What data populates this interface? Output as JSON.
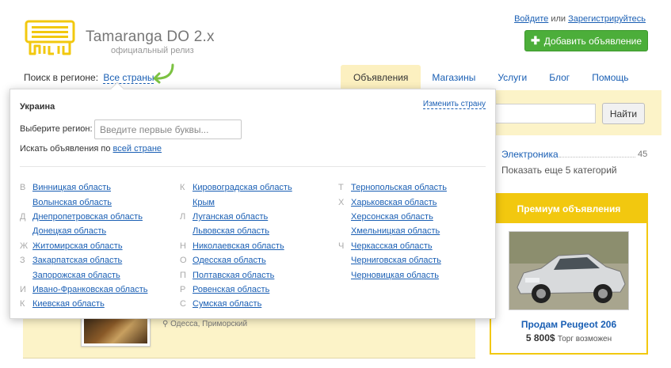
{
  "header": {
    "brand": "Tamaranga DO 2.x",
    "brand_sub": "официальный релиз",
    "auth_login": "Войдите",
    "auth_or": "или",
    "auth_register": "Зарегистрируйтесь",
    "add_button": "Добавить объявление",
    "search_region_label": "Поиск в регионе:",
    "search_region_value": "Все страны"
  },
  "nav": {
    "tabs": [
      {
        "label": "Объявления",
        "active": true
      },
      {
        "label": "Магазины"
      },
      {
        "label": "Услуги"
      },
      {
        "label": "Блог"
      },
      {
        "label": "Помощь"
      }
    ]
  },
  "search": {
    "find_button": "Найти"
  },
  "categories": {
    "item_label": "Электроника",
    "item_count": "45",
    "more": "Показать еще 5 категорий"
  },
  "premium": {
    "title": "Премиум объявления",
    "item_title": "Продам Peugeot 206",
    "price": "5 800$",
    "price_note": "Торг возможен"
  },
  "listing": {
    "location": "Одесса, Приморский"
  },
  "popup": {
    "country": "Украина",
    "change_country": "Изменить страну",
    "choose_region_label": "Выберите регион:",
    "region_placeholder": "Введите первые буквы...",
    "all_country_prefix": "Искать объявления по",
    "all_country_link": "всей стране",
    "columns": [
      [
        {
          "letter": "В",
          "name": "Винницкая область"
        },
        {
          "letter": "",
          "name": "Волынская область"
        },
        {
          "letter": "Д",
          "name": "Днепропетровская область"
        },
        {
          "letter": "",
          "name": "Донецкая область"
        },
        {
          "letter": "Ж",
          "name": "Житомирская область"
        },
        {
          "letter": "З",
          "name": "Закарпатская область"
        },
        {
          "letter": "",
          "name": "Запорожская область"
        },
        {
          "letter": "И",
          "name": "Ивано-Франковская область"
        },
        {
          "letter": "К",
          "name": "Киевская область"
        }
      ],
      [
        {
          "letter": "К",
          "name": "Кировоградская область"
        },
        {
          "letter": "",
          "name": "Крым"
        },
        {
          "letter": "Л",
          "name": "Луганская область"
        },
        {
          "letter": "",
          "name": "Львовская область"
        },
        {
          "letter": "Н",
          "name": "Николаевская область"
        },
        {
          "letter": "О",
          "name": "Одесская область"
        },
        {
          "letter": "П",
          "name": "Полтавская область"
        },
        {
          "letter": "Р",
          "name": "Ровенская область"
        },
        {
          "letter": "С",
          "name": "Сумская область"
        }
      ],
      [
        {
          "letter": "Т",
          "name": "Тернопольская область"
        },
        {
          "letter": "Х",
          "name": "Харьковская область"
        },
        {
          "letter": "",
          "name": "Херсонская область"
        },
        {
          "letter": "",
          "name": "Хмельницкая область"
        },
        {
          "letter": "Ч",
          "name": "Черкасская область"
        },
        {
          "letter": "",
          "name": "Черниговская область"
        },
        {
          "letter": "",
          "name": "Черновицкая область"
        }
      ]
    ]
  },
  "colors": {
    "accent_green": "#4cae3a",
    "link_blue": "#1a5fb4",
    "premium_yellow": "#f2c80f",
    "band_yellow": "#fcf3c8"
  }
}
